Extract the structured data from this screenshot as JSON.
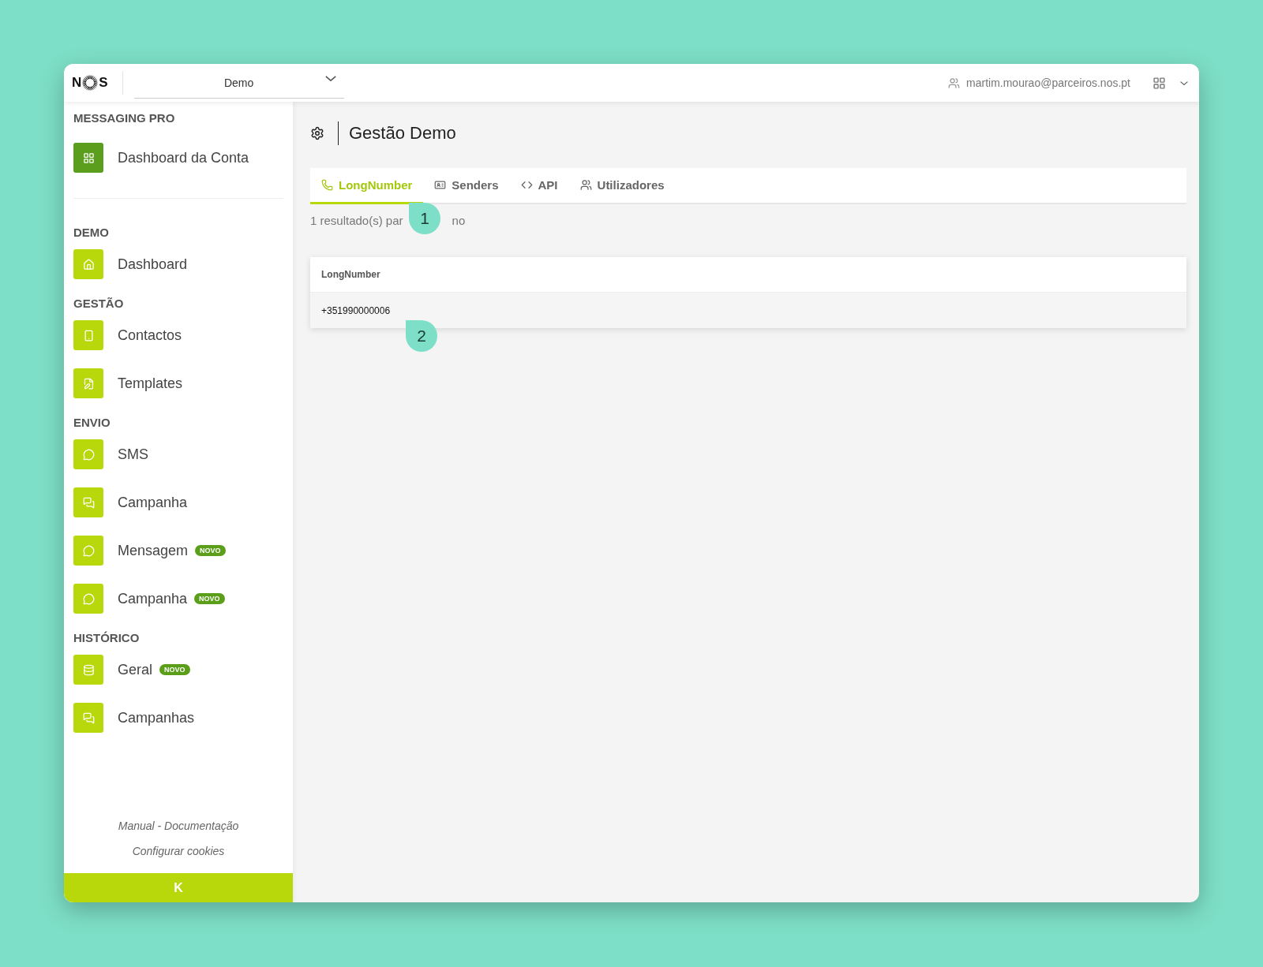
{
  "topbar": {
    "logo": {
      "left": "N",
      "right": "S"
    },
    "account_select": {
      "value": "Demo"
    },
    "user": {
      "email": "martim.mourao@parceiros.nos.pt"
    }
  },
  "sidebar": {
    "sections": [
      {
        "title": "MESSAGING PRO",
        "items": [
          {
            "label": "Dashboard da Conta",
            "color": "#5b9e1d"
          }
        ]
      },
      {
        "title": "DEMO",
        "items": [
          {
            "label": "Dashboard",
            "color": "#b9d80b"
          }
        ]
      },
      {
        "title": "GESTÃO",
        "items": [
          {
            "label": "Contactos",
            "color": "#b9d80b"
          },
          {
            "label": "Templates",
            "color": "#b9d80b"
          }
        ]
      },
      {
        "title": "ENVIO",
        "items": [
          {
            "label": "SMS",
            "color": "#b9d80b"
          },
          {
            "label": "Campanha",
            "color": "#b9d80b"
          },
          {
            "label": "Mensagem",
            "color": "#b9d80b",
            "badge": "NOVO"
          },
          {
            "label": "Campanha",
            "color": "#b9d80b",
            "badge": "NOVO"
          }
        ]
      },
      {
        "title": "HISTÓRICO",
        "items": [
          {
            "label": "Geral",
            "color": "#b9d80b",
            "badge": "NOVO"
          },
          {
            "label": "Campanhas",
            "color": "#b9d80b"
          }
        ]
      }
    ],
    "links": [
      "Manual - Documentação",
      "Configurar cookies"
    ],
    "collapse": "K"
  },
  "page": {
    "title": "Gestão Demo",
    "tabs": [
      {
        "label": "LongNumber",
        "selected": true
      },
      {
        "label": "Senders",
        "selected": false
      },
      {
        "label": "API",
        "selected": false
      },
      {
        "label": "Utilizadores",
        "selected": false
      }
    ],
    "result_text": [
      "1 resultado(s) par",
      "no"
    ],
    "table": {
      "columns": [
        "LongNumber"
      ],
      "rows": [
        [
          "+351990000006"
        ]
      ]
    },
    "markers": [
      "1",
      "2"
    ]
  }
}
